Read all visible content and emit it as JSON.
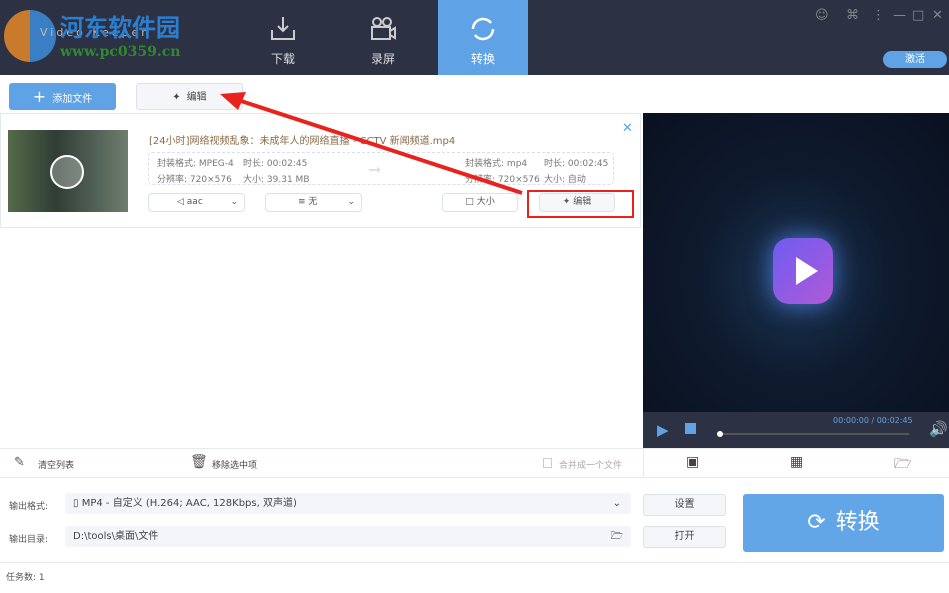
{
  "app": {
    "logo_text": "Video Keeper",
    "watermark_title": "河东软件园",
    "watermark_url": "www.pc0359.cn"
  },
  "tabs": [
    {
      "label": "下载"
    },
    {
      "label": "录屏"
    },
    {
      "label": "转换"
    }
  ],
  "header": {
    "activate_label": "激活"
  },
  "toolbar": {
    "add_file": "添加文件",
    "edit": "编辑"
  },
  "file": {
    "name": "[24小时]网络视频乱象：未成年人的网络直播 - CCTV 新闻频道.mp4",
    "source": {
      "format_label": "封装格式:",
      "format": "MPEG-4",
      "duration_label": "时长:",
      "duration": "00:02:45",
      "resolution_label": "分辨率:",
      "resolution": "720×576",
      "size_label": "大小:",
      "size": "39.31 MB"
    },
    "target": {
      "format_label": "封装格式:",
      "format": "mp4",
      "duration_label": "时长:",
      "duration": "00:02:45",
      "resolution_label": "分辨率:",
      "resolution": "720×576",
      "size_label": "大小:",
      "size": "自动"
    },
    "audio": "aac",
    "subtitle": "无",
    "size_btn": "大小",
    "edit_btn": "编辑"
  },
  "player": {
    "time": "00:00:00 / 00:02:45",
    "progress": 0
  },
  "bottombar": {
    "clear": "清空列表",
    "remove": "移除选中项",
    "merge": "合并成一个文件"
  },
  "output": {
    "format_label": "输出格式:",
    "format_value": "MP4 - 自定义 (H.264; AAC, 128Kbps, 双声道)",
    "dir_label": "输出目录:",
    "dir_value": "D:\\tools\\桌面\\文件",
    "settings": "设置",
    "open": "打开",
    "convert": "转换"
  },
  "status": {
    "tasks": "任务数: 1"
  },
  "colors": {
    "header": "#2d3144",
    "accent": "#5fa3e6",
    "annotation": "#e8231d"
  }
}
